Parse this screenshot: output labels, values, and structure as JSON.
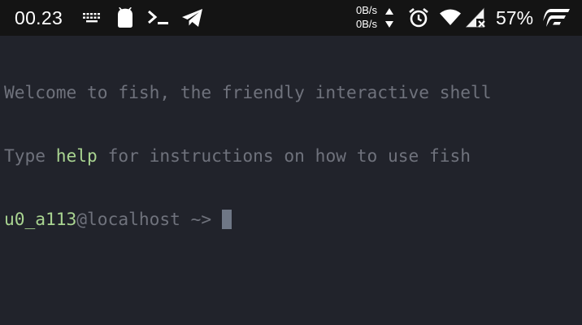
{
  "status_bar": {
    "time": "00.23",
    "speed_up": "0B/s",
    "speed_down": "0B/s",
    "battery_percent": "57%",
    "icons": [
      "keyboard-icon",
      "android-icon",
      "terminal-icon",
      "telegram-icon",
      "network-speed-arrows-icon",
      "alarm-icon",
      "wifi-icon",
      "signal-no-service-icon",
      "brand-logo-icon"
    ]
  },
  "terminal": {
    "welcome_line": "Welcome to fish, the friendly interactive shell",
    "help_line": {
      "prefix": "Type ",
      "keyword": "help",
      "suffix": " for instructions on how to use fish"
    },
    "prompt": {
      "user": "u0_a113",
      "host_separator": "@localhost ",
      "dir_symbol": "~> "
    },
    "colors": {
      "background": "#21232b",
      "text": "#6f727c",
      "accent_green": "#a9d491",
      "cursor": "#6f7786"
    }
  }
}
